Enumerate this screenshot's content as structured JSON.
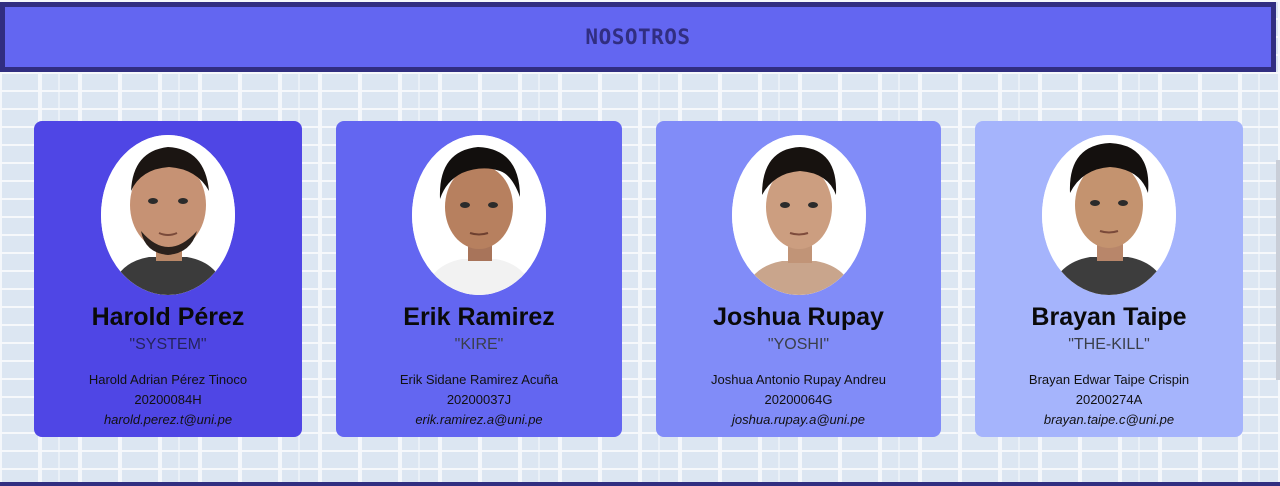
{
  "header": {
    "title": "NOSOTROS"
  },
  "members": [
    {
      "name": "Harold Pérez",
      "alias": "\"SYSTEM\"",
      "full_name": "Harold Adrian Pérez Tinoco",
      "code": "20200084H",
      "email": "harold.perez.t@uni.pe",
      "card_color": "#4f46e5"
    },
    {
      "name": "Erik Ramirez",
      "alias": "\"KIRE\"",
      "full_name": "Erik Sidane Ramirez Acuña",
      "code": "20200037J",
      "email": "erik.ramirez.a@uni.pe",
      "card_color": "#6366f1"
    },
    {
      "name": "Joshua Rupay",
      "alias": "\"YOSHI\"",
      "full_name": "Joshua Antonio Rupay Andreu",
      "code": "20200064G",
      "email": "joshua.rupay.a@uni.pe",
      "card_color": "#818cf8"
    },
    {
      "name": "Brayan Taipe",
      "alias": "\"THE-KILL\"",
      "full_name": "Brayan Edwar Taipe Crispin",
      "code": "20200274A",
      "email": "brayan.taipe.c@uni.pe",
      "card_color": "#a5b4fc"
    }
  ],
  "colors": {
    "header_bg": "#6366f1",
    "header_border": "#312e81",
    "wall": "#dce6f2"
  }
}
